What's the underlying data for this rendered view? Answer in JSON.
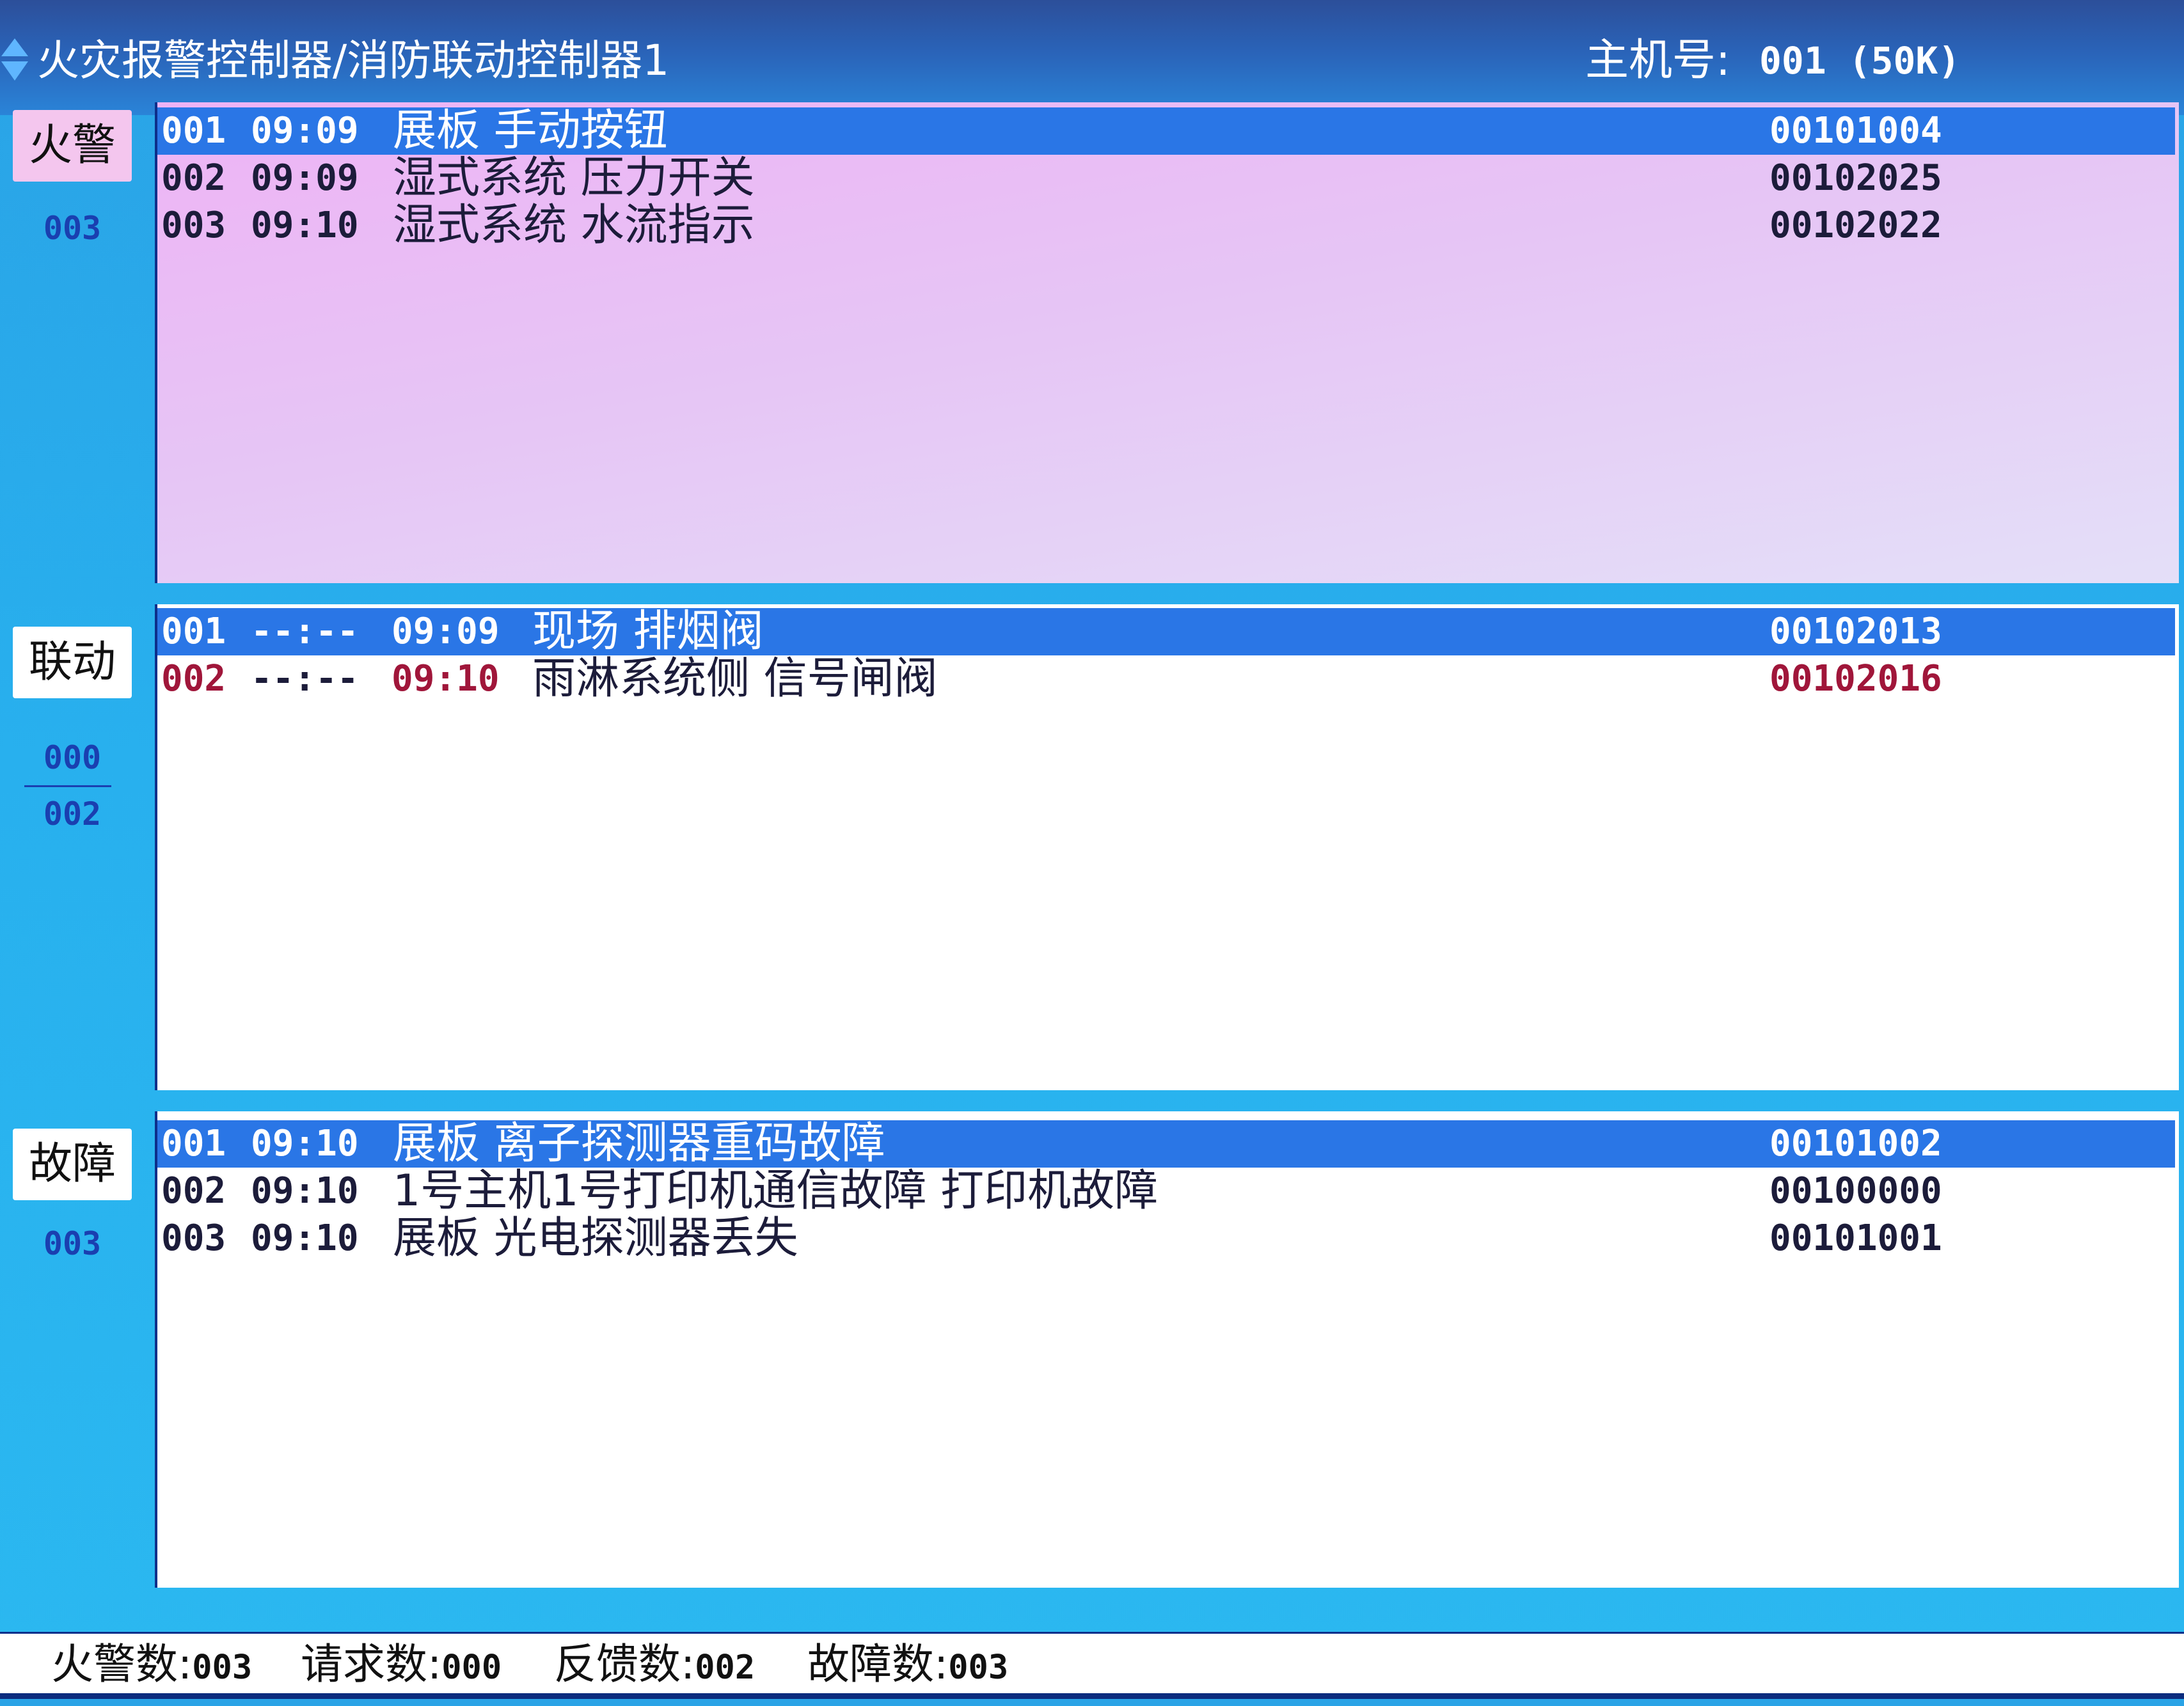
{
  "header": {
    "title": "火灾报警控制器/消防联动控制器1",
    "host_label": "主机号:",
    "host_value": "001 (50K)",
    "title_icon": "diamond-icon"
  },
  "colors": {
    "background": "#2bb0ee",
    "title_bar": "#2a5bb0",
    "selected_row": "#2a76e6",
    "alarm_panel": "#e8c4f5",
    "pending_row_text": "#a0163a",
    "count_text": "#1a3fb0"
  },
  "fire_alarm": {
    "tag": "火警",
    "count": "003",
    "rows": [
      {
        "no": "001",
        "time": "09:09",
        "desc": "展板 手动按钮",
        "code": "00101004"
      },
      {
        "no": "002",
        "time": "09:09",
        "desc": "湿式系统 压力开关",
        "code": "00102025"
      },
      {
        "no": "003",
        "time": "09:10",
        "desc": "湿式系统 水流指示",
        "code": "00102022"
      }
    ]
  },
  "linkage": {
    "tag": "联动",
    "count_top": "000",
    "count_bottom": "002",
    "rows": [
      {
        "no": "001",
        "start": "--:--",
        "time": "09:09",
        "desc": "现场 排烟阀",
        "code": "00102013"
      },
      {
        "no": "002",
        "start": "--:--",
        "time": "09:10",
        "desc": "雨淋系统侧 信号闸阀",
        "code": "00102016"
      }
    ]
  },
  "fault": {
    "tag": "故障",
    "count": "003",
    "rows": [
      {
        "no": "001",
        "time": "09:10",
        "desc": "展板 离子探测器重码故障",
        "code": "00101002"
      },
      {
        "no": "002",
        "time": "09:10",
        "desc": "1号主机1号打印机通信故障 打印机故障",
        "code": "00100000"
      },
      {
        "no": "003",
        "time": "09:10",
        "desc": "展板 光电探测器丢失",
        "code": "00101001"
      }
    ]
  },
  "status": {
    "fire_label": "火警数:",
    "fire_value": "003",
    "request_label": "请求数:",
    "request_value": "000",
    "feedback_label": "反馈数:",
    "feedback_value": "002",
    "fault_label": "故障数:",
    "fault_value": "003"
  }
}
